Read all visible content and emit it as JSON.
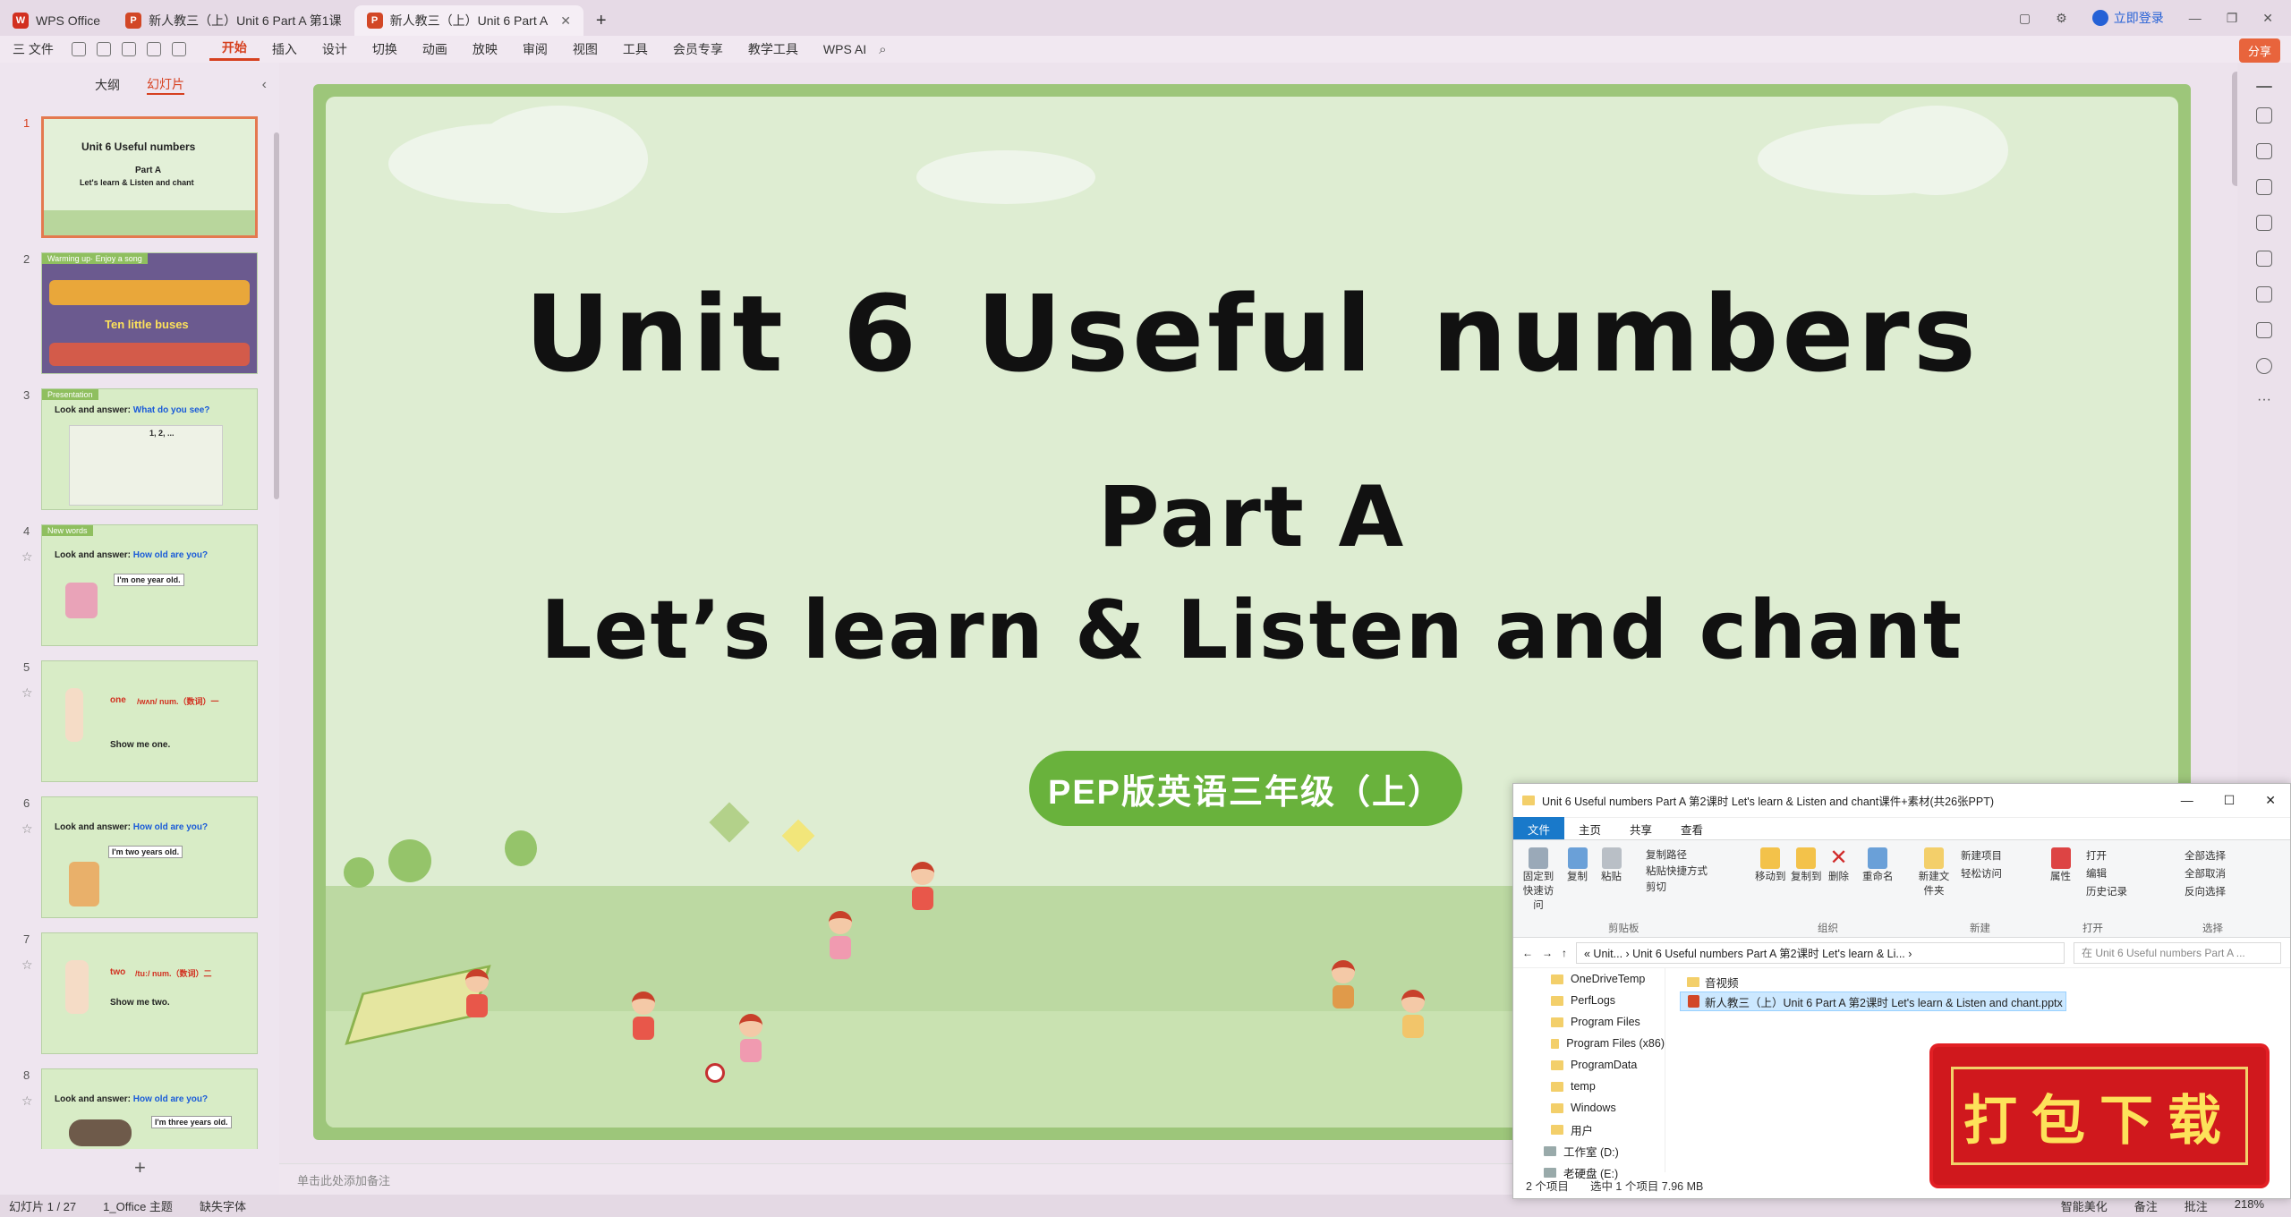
{
  "tabs": [
    {
      "label": "WPS Office",
      "color": "#d23020"
    },
    {
      "label": "新人教三（上）Unit 6 Part A 第1课",
      "color": "#d24726"
    },
    {
      "label": "新人教三（上）Unit 6 Part A",
      "color": "#d24726",
      "active": true
    }
  ],
  "window": {
    "login_label": "立即登录",
    "share_label": "分享"
  },
  "menu": {
    "file_label": "三 文件",
    "items": [
      "开始",
      "插入",
      "设计",
      "切换",
      "动画",
      "放映",
      "审阅",
      "视图",
      "工具",
      "会员专享",
      "教学工具"
    ],
    "ai_label": "WPS AI"
  },
  "left_panel": {
    "tab_outline": "大纲",
    "tab_slides": "幻灯片",
    "thumbs": [
      {
        "num": "1",
        "header": "",
        "title": "Unit 6  Useful numbers",
        "line2": "Part A",
        "line3": "Let's learn & Listen and chant"
      },
      {
        "num": "2",
        "header": "Warming up· Enjoy a song",
        "title": "Ten little buses",
        "line2": "",
        "line3": ""
      },
      {
        "num": "3",
        "header": "Presentation",
        "title": "Look and answer:",
        "blue": "What do you see?",
        "line2": "1, 2, ...",
        "line3": ""
      },
      {
        "num": "4",
        "header": "New words",
        "title": "Look and answer:",
        "blue": "How old are you?",
        "line2": "I'm one year old.",
        "line3": ""
      },
      {
        "num": "5",
        "header": "",
        "title": "one",
        "red": "/wʌn/  num.（数词）一",
        "line2": "Show me one.",
        "line3": ""
      },
      {
        "num": "6",
        "header": "",
        "title": "Look and answer:",
        "blue": "How old are you?",
        "line2": "I'm two years old.",
        "line3": ""
      },
      {
        "num": "7",
        "header": "",
        "title": "two",
        "red": "/tuː/  num.（数词）二",
        "line2": "Show me two.",
        "line3": ""
      },
      {
        "num": "8",
        "header": "",
        "title": "Look and answer:",
        "blue": "How old are you?",
        "line2": "I'm three years old.",
        "line3": ""
      }
    ]
  },
  "slide": {
    "title": "Unit 6  Useful numbers",
    "part": "Part A",
    "subtitle": "Let’s learn & Listen and chant",
    "badge": "PEP版英语三年级（上）"
  },
  "notes_placeholder": "单击此处添加备注",
  "status": {
    "slide_counter": "幻灯片 1 / 27",
    "theme": "1_Office 主题",
    "missing_font": "缺失字体",
    "smart": "智能美化",
    "notes": "备注",
    "comments": "批注",
    "zoom": "218%"
  },
  "explorer": {
    "title": "Unit 6 Useful numbers  Part A 第2课时 Let's learn & Listen and chant课件+素材(共26张PPT)",
    "ribbon_tabs": [
      "文件",
      "主页",
      "共享",
      "查看"
    ],
    "ribbon": {
      "pin": "固定到快速访问",
      "copy": "复制",
      "paste": "粘贴",
      "copy_path": "复制路径",
      "paste_shortcut": "粘贴快捷方式",
      "cut": "剪切",
      "move_to": "移动到",
      "copy_to": "复制到",
      "delete": "删除",
      "rename": "重命名",
      "new_folder": "新建文件夹",
      "new_item": "新建项目",
      "easy_access": "轻松访问",
      "properties": "属性",
      "open": "打开",
      "edit": "编辑",
      "history": "历史记录",
      "select_all": "全部选择",
      "select_none": "全部取消",
      "invert": "反向选择",
      "grp_clipboard": "剪贴板",
      "grp_organize": "组织",
      "grp_new": "新建",
      "grp_open": "打开",
      "grp_select": "选择"
    },
    "path": "« Unit... › Unit 6 Useful numbers  Part A 第2课时 Let's learn & Li... ›",
    "search_placeholder": "在 Unit 6 Useful numbers  Part A ...",
    "nav": [
      "OneDriveTemp",
      "PerfLogs",
      "Program Files",
      "Program Files (x86)",
      "ProgramData",
      "temp",
      "Windows",
      "用户",
      "工作室 (D:)",
      "老硬盘 (E:)"
    ],
    "files": [
      "音视频",
      "新人教三（上）Unit 6 Part A 第2课时 Let's learn & Listen and chant.pptx"
    ],
    "status_items": "2 个项目",
    "status_selected": "选中 1 个项目  7.96 MB"
  },
  "stamp_label": "打包下载"
}
